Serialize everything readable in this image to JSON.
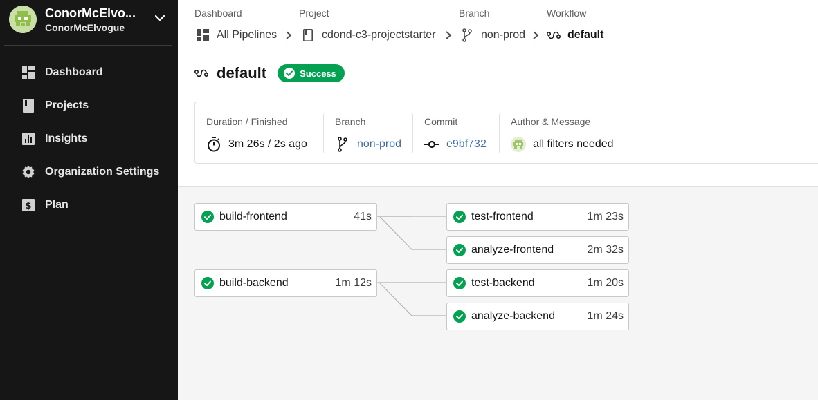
{
  "org": {
    "name": "ConorMcElvo...",
    "username": "ConorMcElvogue"
  },
  "sidebar": {
    "items": [
      {
        "label": "Dashboard",
        "icon": "dashboard-icon"
      },
      {
        "label": "Projects",
        "icon": "projects-icon"
      },
      {
        "label": "Insights",
        "icon": "insights-icon"
      },
      {
        "label": "Organization Settings",
        "icon": "gear-icon"
      },
      {
        "label": "Plan",
        "icon": "dollar-icon"
      }
    ]
  },
  "breadcrumb": {
    "dashboard": {
      "label": "Dashboard",
      "value": "All Pipelines"
    },
    "project": {
      "label": "Project",
      "value": "cdond-c3-projectstarter"
    },
    "branch": {
      "label": "Branch",
      "value": "non-prod"
    },
    "workflow": {
      "label": "Workflow",
      "value": "default"
    }
  },
  "workflow": {
    "title": "default",
    "status": "Success",
    "status_color": "#04a152"
  },
  "summary": {
    "duration": {
      "label": "Duration / Finished",
      "value": "3m 26s / 2s ago"
    },
    "branch": {
      "label": "Branch",
      "value": "non-prod"
    },
    "commit": {
      "label": "Commit",
      "value": "e9bf732"
    },
    "author": {
      "label": "Author & Message",
      "message": "all filters needed"
    }
  },
  "jobs": [
    {
      "name": "build-frontend",
      "duration": "41s",
      "status": "success"
    },
    {
      "name": "test-frontend",
      "duration": "1m 23s",
      "status": "success"
    },
    {
      "name": "analyze-frontend",
      "duration": "2m 32s",
      "status": "success"
    },
    {
      "name": "build-backend",
      "duration": "1m 12s",
      "status": "success"
    },
    {
      "name": "test-backend",
      "duration": "1m 20s",
      "status": "success"
    },
    {
      "name": "analyze-backend",
      "duration": "1m 24s",
      "status": "success"
    }
  ],
  "colors": {
    "sidebar_bg": "#161616",
    "success": "#04a152",
    "link": "#3f6ea7"
  }
}
